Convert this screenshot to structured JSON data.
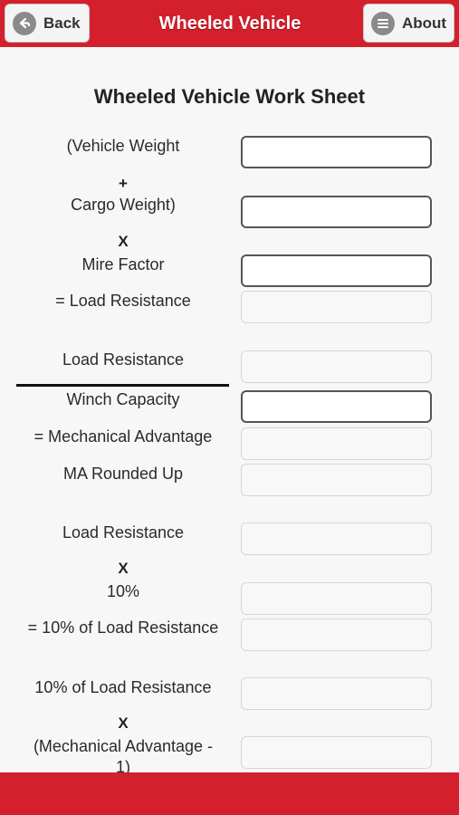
{
  "header": {
    "title": "Wheeled Vehicle",
    "back_label": "Back",
    "about_label": "About",
    "back_icon": "back-arrow-icon",
    "about_icon": "menu-lines-icon",
    "accent_color": "#d4202c"
  },
  "worksheet": {
    "title": "Wheeled Vehicle Work Sheet",
    "labels": {
      "vehicle_weight": "(Vehicle Weight",
      "plus": "+",
      "cargo_weight": "Cargo Weight)",
      "times1": "X",
      "mire_factor": "Mire Factor",
      "eq_load_resistance": "= Load Resistance",
      "load_resistance1": "Load Resistance",
      "winch_capacity": "Winch Capacity",
      "eq_mechanical_advantage": "= Mechanical Advantage",
      "ma_rounded_up": "MA Rounded Up",
      "load_resistance2": "Load Resistance",
      "times2": "X",
      "ten_percent": "10%",
      "eq_ten_percent_load": "= 10% of Load Resistance",
      "ten_percent_load": "10% of Load Resistance",
      "times3": "X",
      "mech_adv_minus1_a": "(Mechanical Advantage -",
      "mech_adv_minus1_b": "1)"
    },
    "values": {
      "vehicle_weight": "",
      "cargo_weight": "",
      "mire_factor": "",
      "load_resistance": "",
      "load_resistance_copy": "",
      "winch_capacity": "",
      "mechanical_advantage": "",
      "ma_rounded_up": "",
      "load_resistance_copy2": "",
      "ten_percent": "",
      "ten_percent_load": "",
      "ten_percent_load_copy": "",
      "mech_adv_minus1": ""
    }
  }
}
